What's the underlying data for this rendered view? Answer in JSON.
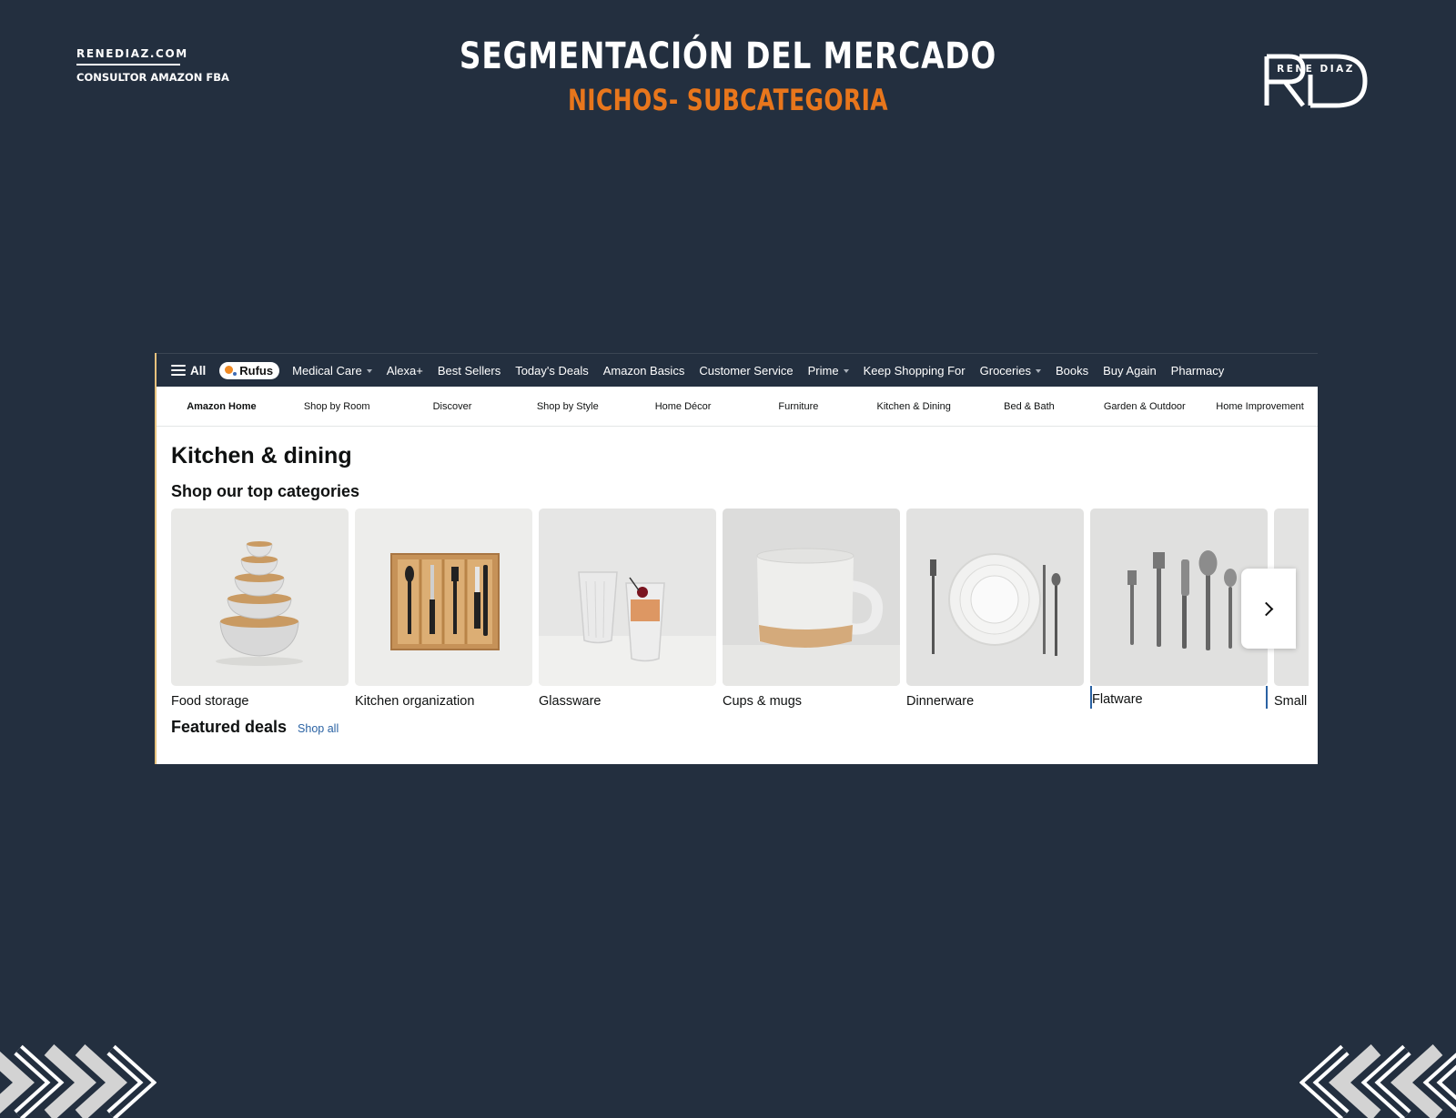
{
  "slide": {
    "brand_site": "RENEDIAZ.COM",
    "brand_role": "CONSULTOR AMAZON FBA",
    "title": "SEGMENTACIÓN DEL MERCADO",
    "subtitle": "NICHOS- SUBCATEGORIA",
    "logo_text": "RENE DIAZ",
    "logo_letters": "RD",
    "accent_color": "#e8761c",
    "background_color": "#232f3f"
  },
  "nav": {
    "all_label": "All",
    "rufus_label": "Rufus",
    "items": [
      {
        "label": "Medical Care",
        "dropdown": true
      },
      {
        "label": "Alexa+",
        "dropdown": false
      },
      {
        "label": "Best Sellers",
        "dropdown": false
      },
      {
        "label": "Today's Deals",
        "dropdown": false
      },
      {
        "label": "Amazon Basics",
        "dropdown": false
      },
      {
        "label": "Customer Service",
        "dropdown": false
      },
      {
        "label": "Prime",
        "dropdown": true
      },
      {
        "label": "Keep Shopping For",
        "dropdown": false
      },
      {
        "label": "Groceries",
        "dropdown": true
      },
      {
        "label": "Books",
        "dropdown": false
      },
      {
        "label": "Buy Again",
        "dropdown": false
      },
      {
        "label": "Pharmacy",
        "dropdown": false
      }
    ]
  },
  "subnav": {
    "items": [
      {
        "label": "Amazon Home",
        "active": true
      },
      {
        "label": "Shop by Room"
      },
      {
        "label": "Discover"
      },
      {
        "label": "Shop by Style"
      },
      {
        "label": "Home Décor"
      },
      {
        "label": "Furniture"
      },
      {
        "label": "Kitchen & Dining"
      },
      {
        "label": "Bed & Bath"
      },
      {
        "label": "Garden & Outdoor"
      },
      {
        "label": "Home Improvement"
      }
    ]
  },
  "main": {
    "page_title": "Kitchen & dining",
    "section_title": "Shop our top categories",
    "categories": [
      {
        "label": "Food storage",
        "icon": "nested-bowls-image"
      },
      {
        "label": "Kitchen organization",
        "icon": "utensil-tray-image"
      },
      {
        "label": "Glassware",
        "icon": "glasses-image"
      },
      {
        "label": "Cups & mugs",
        "icon": "mug-image"
      },
      {
        "label": "Dinnerware",
        "icon": "plates-image"
      },
      {
        "label": "Flatware",
        "icon": "flatware-image",
        "focused": true
      },
      {
        "label": "Small",
        "icon": "small-appliance-image"
      }
    ],
    "next_icon": "chevron-right-icon",
    "deals_title": "Featured deals",
    "deals_link": "Shop all"
  }
}
